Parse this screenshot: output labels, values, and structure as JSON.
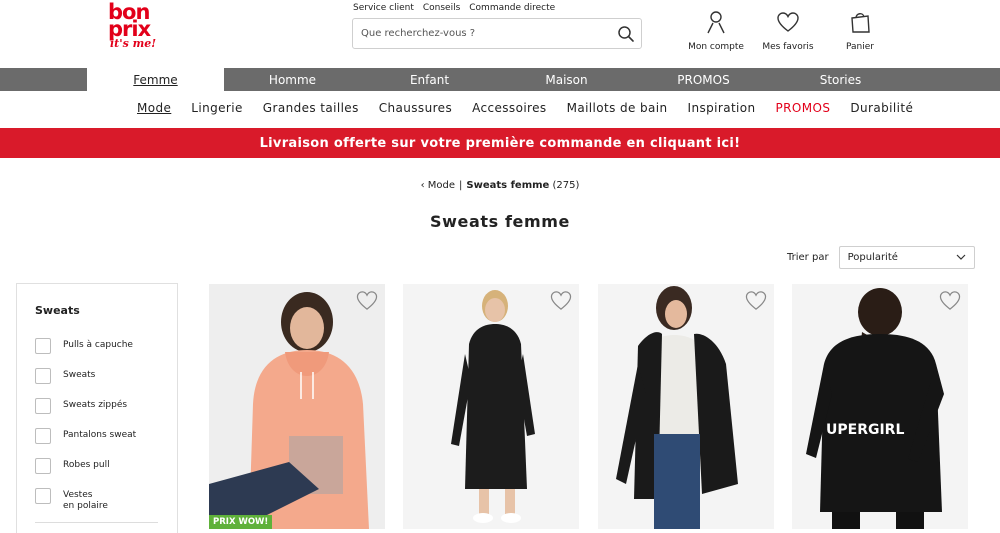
{
  "brand": {
    "line1": "bon",
    "line2": "prix",
    "tagline": "it's me!"
  },
  "toplinks": [
    "Service client",
    "Conseils",
    "Commande directe"
  ],
  "search": {
    "placeholder": "Que recherchez-vous ?"
  },
  "header_actions": [
    {
      "label": "Mon compte",
      "icon": "user-icon"
    },
    {
      "label": "Mes favoris",
      "icon": "heart-icon"
    },
    {
      "label": "Panier",
      "icon": "bag-icon"
    }
  ],
  "categories": [
    {
      "label": "Femme",
      "active": true
    },
    {
      "label": "Homme"
    },
    {
      "label": "Enfant"
    },
    {
      "label": "Maison"
    },
    {
      "label": "PROMOS"
    },
    {
      "label": "Stories"
    }
  ],
  "subnav": [
    {
      "label": "Mode",
      "active": true
    },
    {
      "label": "Lingerie"
    },
    {
      "label": "Grandes tailles"
    },
    {
      "label": "Chaussures"
    },
    {
      "label": "Accessoires"
    },
    {
      "label": "Maillots de bain"
    },
    {
      "label": "Inspiration"
    },
    {
      "label": "PROMOS",
      "highlight": true
    },
    {
      "label": "Durabilité"
    }
  ],
  "banner": {
    "text": "Livraison offerte sur votre première commande en cliquant ici!"
  },
  "breadcrumb": {
    "parent": "Mode",
    "current": "Sweats femme",
    "count": "(275)"
  },
  "page_title": "Sweats femme",
  "sort": {
    "label": "Trier par",
    "selected": "Popularité"
  },
  "filter": {
    "title": "Sweats",
    "options": [
      "Pulls à capuche",
      "Sweats",
      "Sweats zippés",
      "Pantalons sweat",
      "Robes pull",
      "Vestes\nen polaire"
    ]
  },
  "products": [
    {
      "badge": "PRIX WOW!",
      "color": "#f4a98c"
    },
    {
      "badge": "",
      "color": "#1c1c1c"
    },
    {
      "badge": "",
      "color": "#1a1a1a"
    },
    {
      "badge": "",
      "color": "#151515",
      "print": "UPERGIRL"
    }
  ],
  "colors": {
    "brand_red": "#e2001a",
    "banner_red": "#d91a2a",
    "nav_grey": "#6b6b6b",
    "badge_green": "#5fb13a"
  }
}
